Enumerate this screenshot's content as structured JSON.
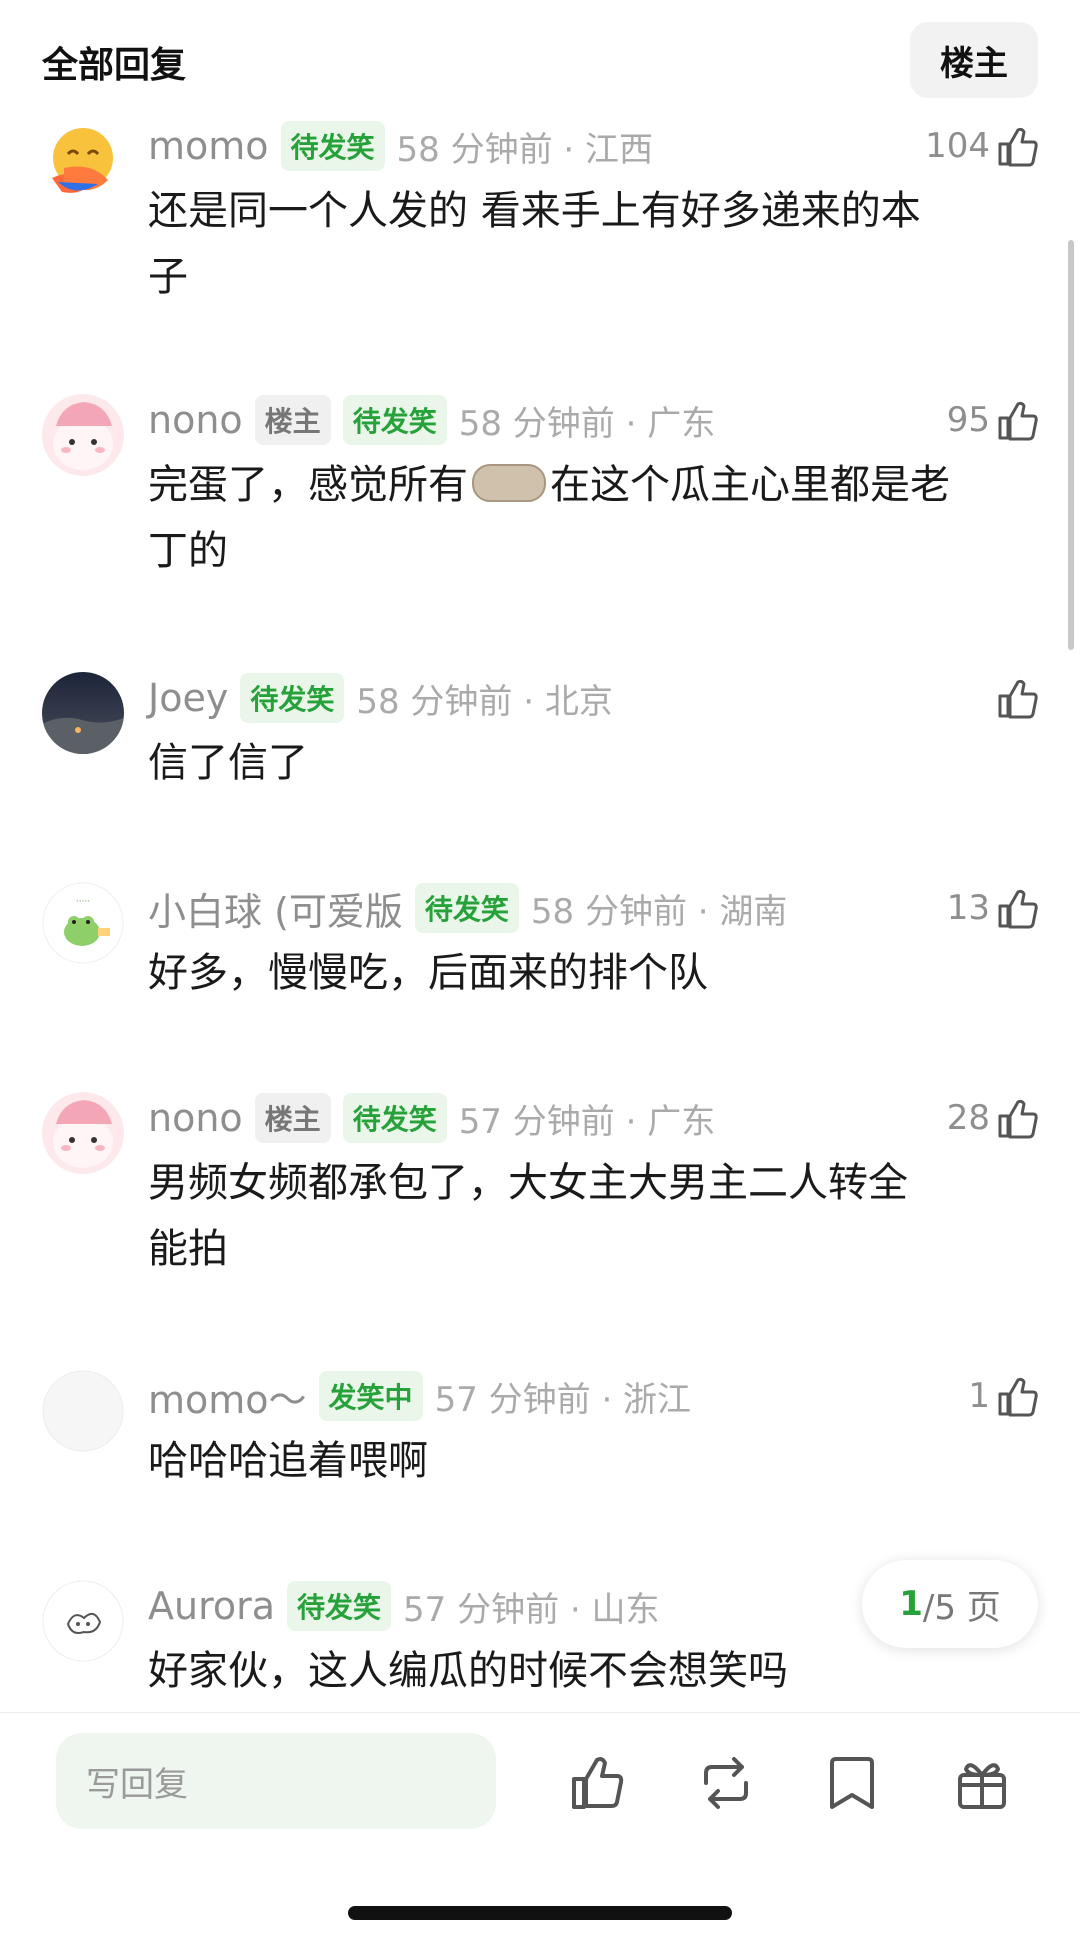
{
  "header": {
    "title": "全部回复",
    "owner_button": "楼主"
  },
  "comments": [
    {
      "name": "momo",
      "badges": [
        {
          "text": "待发笑",
          "type": "laugh"
        }
      ],
      "time": "58 分钟前 · 江西",
      "likes": "104",
      "content_lines": [
        "还是同一个人发的  看来手上有好多递来的本",
        "子"
      ],
      "avatar": "hug-emoji-avatar"
    },
    {
      "name": "nono",
      "badges": [
        {
          "text": "楼主",
          "type": "owner"
        },
        {
          "text": "待发笑",
          "type": "laugh"
        }
      ],
      "time": "58 分钟前 · 广东",
      "likes": "95",
      "content_before_emoji": "完蛋了，感觉所有",
      "content_after_emoji": "在这个瓜主心里都是老",
      "content_line2": "丁的",
      "avatar": "pink-bunny-avatar"
    },
    {
      "name": "Joey",
      "badges": [
        {
          "text": "待发笑",
          "type": "laugh"
        }
      ],
      "time": "58 分钟前 · 北京",
      "likes": "",
      "content_lines": [
        "信了信了"
      ],
      "avatar": "night-sky-avatar"
    },
    {
      "name": "小白球 (可爱版",
      "badges": [
        {
          "text": "待发笑",
          "type": "laugh"
        }
      ],
      "time": "58 分钟前 · 湖南",
      "likes": "13",
      "content_lines": [
        "好多，慢慢吃，后面来的排个队"
      ],
      "avatar": "frog-avatar"
    },
    {
      "name": "nono",
      "badges": [
        {
          "text": "楼主",
          "type": "owner"
        },
        {
          "text": "待发笑",
          "type": "laugh"
        }
      ],
      "time": "57 分钟前 · 广东",
      "likes": "28",
      "content_lines": [
        "男频女频都承包了，大女主大男主二人转全",
        "能拍"
      ],
      "avatar": "pink-bunny-avatar"
    },
    {
      "name": "momo～",
      "badges": [
        {
          "text": "发笑中",
          "type": "laugh"
        }
      ],
      "time": "57 分钟前 · 浙江",
      "likes": "1",
      "content_lines": [
        "哈哈哈追着喂啊"
      ],
      "avatar": "blank-avatar"
    },
    {
      "name": "Aurora",
      "badges": [
        {
          "text": "待发笑",
          "type": "laugh"
        }
      ],
      "time": "57 分钟前 · 山东",
      "likes": "",
      "content_lines": [
        "好家伙，这人编瓜的时候不会想笑吗"
      ],
      "avatar": "doodle-avatar"
    }
  ],
  "pagination": {
    "current": "1",
    "total": "/5 页"
  },
  "bottom_bar": {
    "reply_placeholder": "写回复",
    "icons": [
      "thumbs-up-icon",
      "repost-icon",
      "bookmark-icon",
      "gift-icon"
    ]
  },
  "colors": {
    "accent_green": "#27a23a",
    "badge_green_bg": "#eaf6ea",
    "input_bg": "#eff6ef"
  }
}
